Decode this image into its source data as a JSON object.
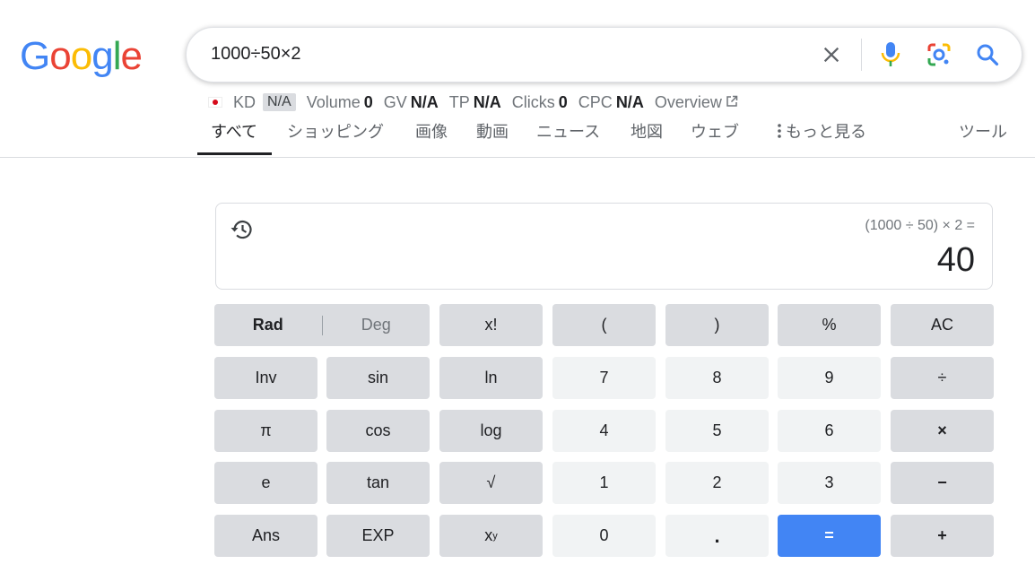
{
  "logo": {
    "letters": [
      "G",
      "o",
      "o",
      "g",
      "l",
      "e"
    ],
    "colors": [
      "#4285F4",
      "#EA4335",
      "#FBBC05",
      "#4285F4",
      "#34A853",
      "#EA4335"
    ]
  },
  "search": {
    "query": "1000÷50×2"
  },
  "icons": {
    "clear": "close-icon",
    "voice": "microphone-icon",
    "lens": "lens-camera-icon",
    "search": "search-icon",
    "history": "history-icon"
  },
  "metrics": {
    "flag": "japan-flag",
    "kd_label": "KD",
    "kd_value": "N/A",
    "volume_label": "Volume",
    "volume_value": "0",
    "gv_label": "GV",
    "gv_value": "N/A",
    "tp_label": "TP",
    "tp_value": "N/A",
    "clicks_label": "Clicks",
    "clicks_value": "0",
    "cpc_label": "CPC",
    "cpc_value": "N/A",
    "overview_label": "Overview"
  },
  "tabs": {
    "all": "すべて",
    "shopping": "ショッピング",
    "images": "画像",
    "videos": "動画",
    "news": "ニュース",
    "maps": "地図",
    "web": "ウェブ",
    "more": "もっと見る",
    "tools": "ツール"
  },
  "calculator": {
    "expression": "(1000 ÷ 50) × 2 =",
    "result": "40",
    "rad": "Rad",
    "deg": "Deg",
    "keys": {
      "fact": "x!",
      "lparen": "(",
      "rparen": ")",
      "percent": "%",
      "ac": "AC",
      "inv": "Inv",
      "sin": "sin",
      "ln": "ln",
      "k7": "7",
      "k8": "8",
      "k9": "9",
      "divide": "÷",
      "pi": "π",
      "cos": "cos",
      "log": "log",
      "k4": "4",
      "k5": "5",
      "k6": "6",
      "multiply": "×",
      "e": "e",
      "tan": "tan",
      "sqrt": "√",
      "k1": "1",
      "k2": "2",
      "k3": "3",
      "minus": "−",
      "ans": "Ans",
      "exp": "EXP",
      "power_base": "x",
      "power_exp": "y",
      "k0": "0",
      "dot": ".",
      "equals": "=",
      "plus": "+"
    },
    "equals_color": "#4285F4"
  }
}
